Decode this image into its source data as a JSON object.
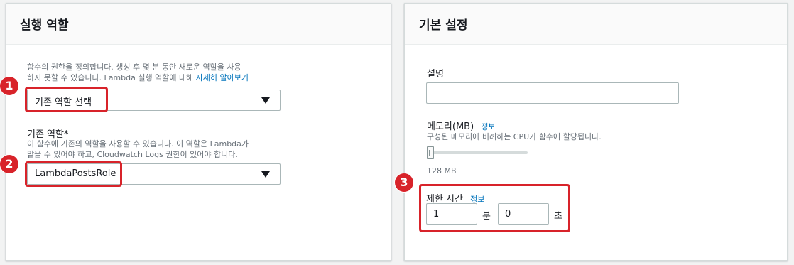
{
  "execution_role": {
    "title": "실행 역할",
    "description_line1": "함수의 권한을 정의합니다. 생성 후 몇 분 동안 새로운 역할을 사용",
    "description_line2_prefix": "하지 못할 수 있습니다. Lambda 실행 역할에 대해 ",
    "learn_more_link": "자세히 알아보기",
    "role_mode_select": "기존 역할 선택",
    "existing_role_label": "기존 역할*",
    "existing_role_desc_line1": "이 함수에 기존의 역할을 사용할 수 있습니다. 이 역할은 Lambda가",
    "existing_role_desc_line2": "맡을 수 있어야 하고, Cloudwatch Logs 권한이 있어야 합니다.",
    "existing_role_select": "LambdaPostsRole"
  },
  "basic_settings": {
    "title": "기본 설정",
    "description_label": "설명",
    "description_value": "",
    "memory_label": "메모리(MB)",
    "memory_info": "정보",
    "memory_desc": "구성된 메모리에 비례하는 CPU가 함수에 할당됩니다.",
    "memory_value": "128 MB",
    "memory_fraction": 0.0,
    "timeout_label": "제한 시간",
    "timeout_info": "정보",
    "timeout_minutes": "1",
    "minutes_unit": "분",
    "timeout_seconds": "0",
    "seconds_unit": "초"
  },
  "annotations": {
    "badge1": "1",
    "badge2": "2",
    "badge3": "3",
    "highlight_color": "#d8232a"
  }
}
